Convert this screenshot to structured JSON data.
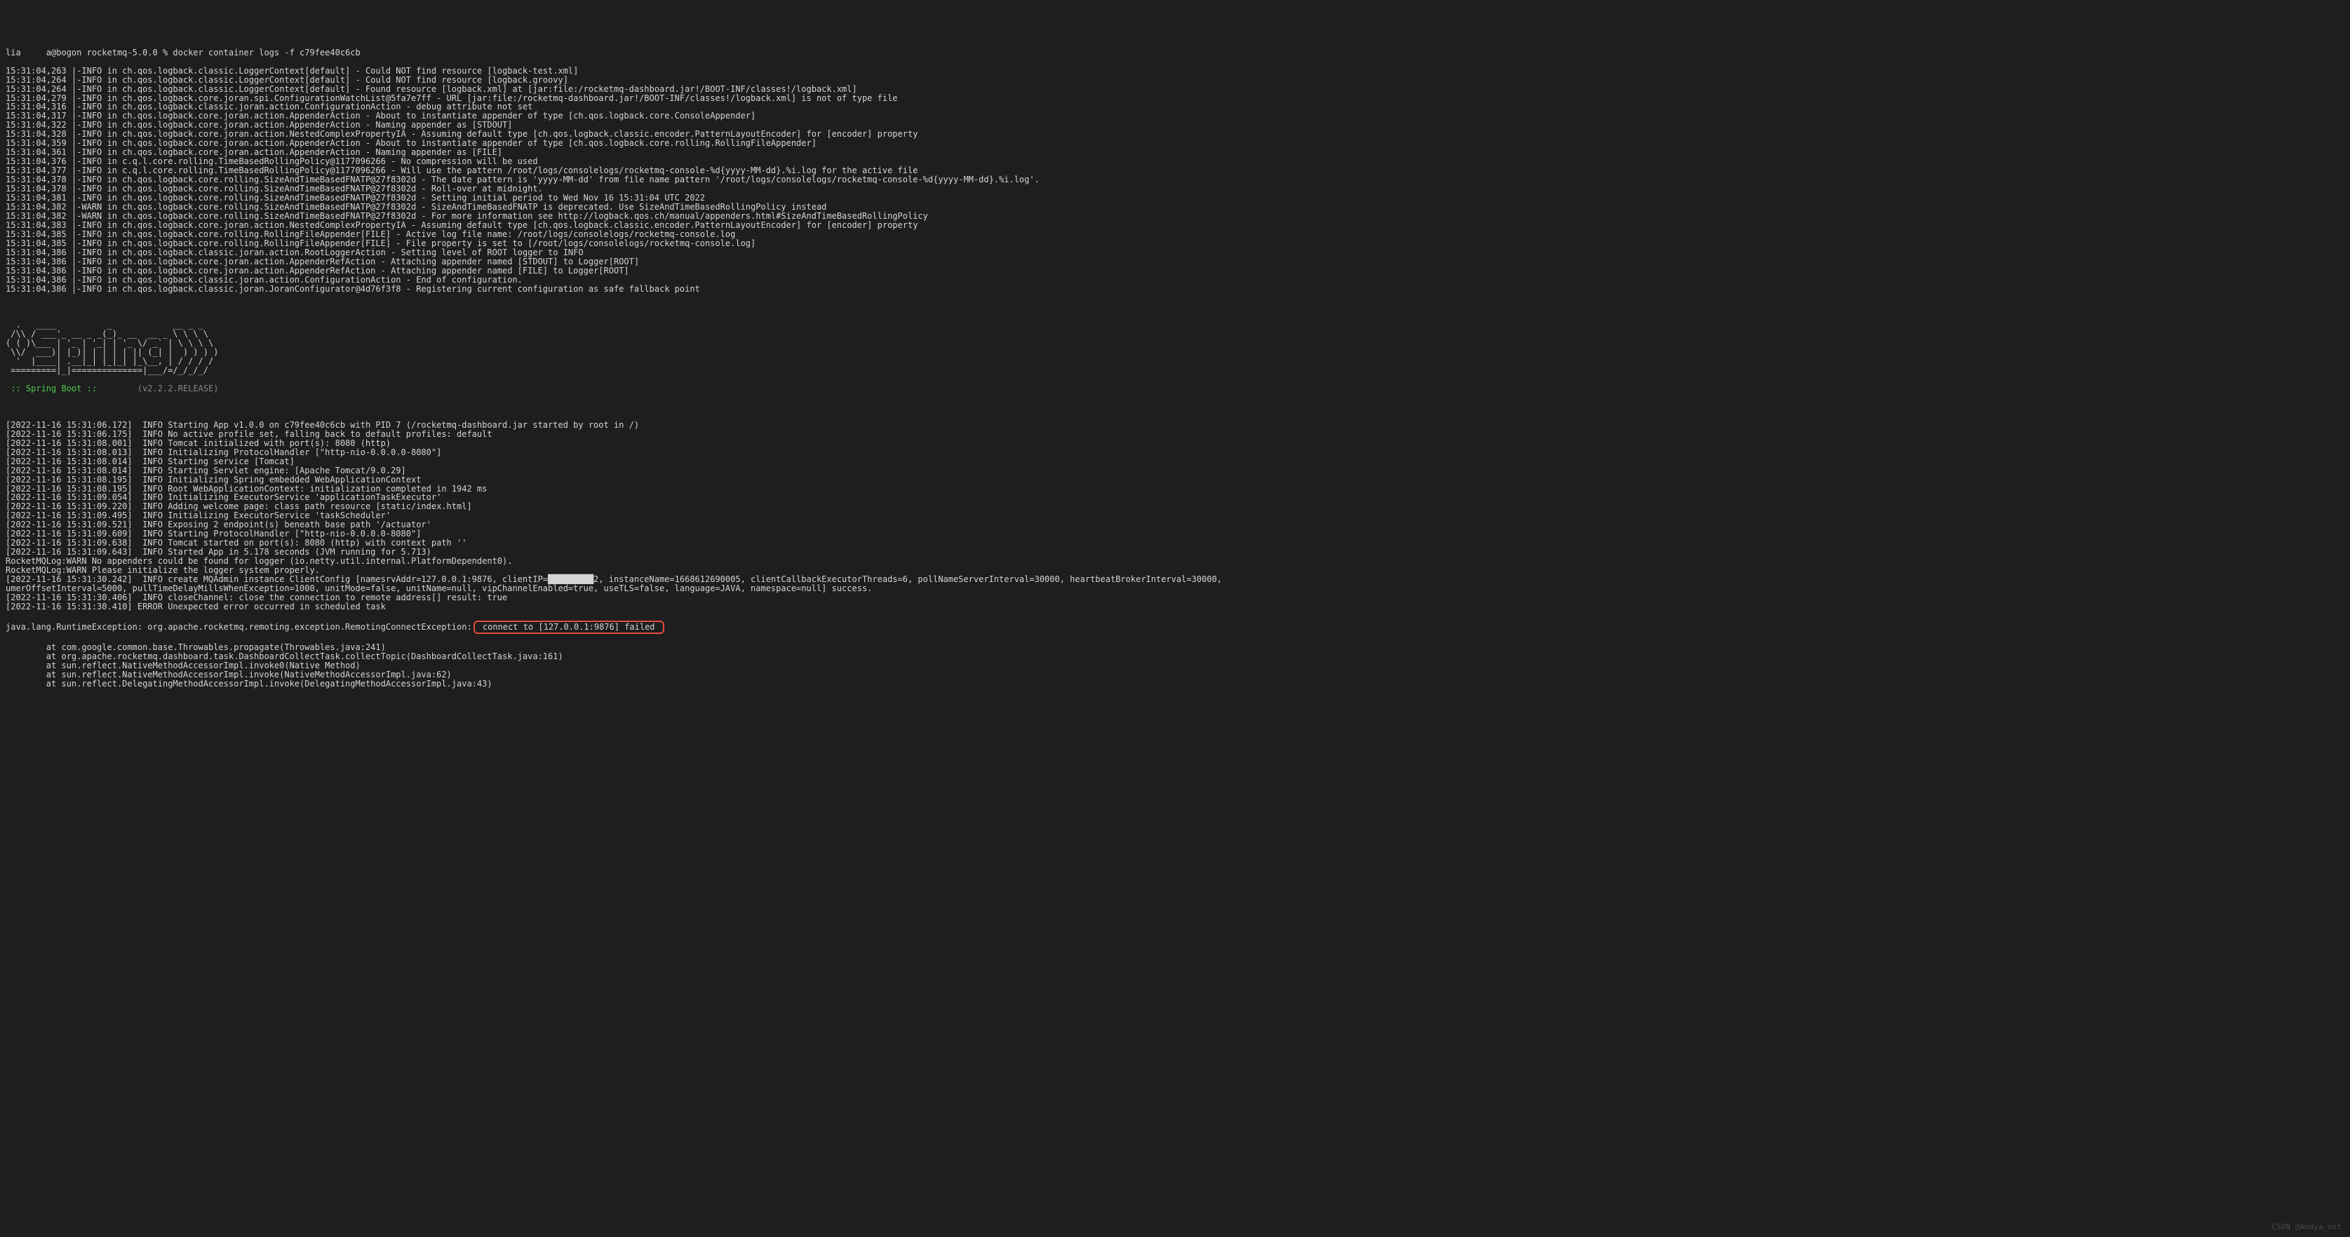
{
  "prompt_line": "lia     a@bogon rocketmq-5.0.0 % docker container logs -f c79fee40c6cb",
  "logback_lines": [
    "15:31:04,263 |-INFO in ch.qos.logback.classic.LoggerContext[default] - Could NOT find resource [logback-test.xml]",
    "15:31:04,264 |-INFO in ch.qos.logback.classic.LoggerContext[default] - Could NOT find resource [logback.groovy]",
    "15:31:04,264 |-INFO in ch.qos.logback.classic.LoggerContext[default] - Found resource [logback.xml] at [jar:file:/rocketmq-dashboard.jar!/BOOT-INF/classes!/logback.xml]",
    "15:31:04,279 |-INFO in ch.qos.logback.core.joran.spi.ConfigurationWatchList@5fa7e7ff - URL [jar:file:/rocketmq-dashboard.jar!/BOOT-INF/classes!/logback.xml] is not of type file",
    "15:31:04,316 |-INFO in ch.qos.logback.classic.joran.action.ConfigurationAction - debug attribute not set",
    "15:31:04,317 |-INFO in ch.qos.logback.core.joran.action.AppenderAction - About to instantiate appender of type [ch.qos.logback.core.ConsoleAppender]",
    "15:31:04,322 |-INFO in ch.qos.logback.core.joran.action.AppenderAction - Naming appender as [STDOUT]",
    "15:31:04,328 |-INFO in ch.qos.logback.core.joran.action.NestedComplexPropertyIA - Assuming default type [ch.qos.logback.classic.encoder.PatternLayoutEncoder] for [encoder] property",
    "15:31:04,359 |-INFO in ch.qos.logback.core.joran.action.AppenderAction - About to instantiate appender of type [ch.qos.logback.core.rolling.RollingFileAppender]",
    "15:31:04,361 |-INFO in ch.qos.logback.core.joran.action.AppenderAction - Naming appender as [FILE]",
    "15:31:04,376 |-INFO in c.q.l.core.rolling.TimeBasedRollingPolicy@1177096266 - No compression will be used",
    "15:31:04,377 |-INFO in c.q.l.core.rolling.TimeBasedRollingPolicy@1177096266 - Will use the pattern /root/logs/consolelogs/rocketmq-console-%d{yyyy-MM-dd}.%i.log for the active file",
    "15:31:04,378 |-INFO in ch.qos.logback.core.rolling.SizeAndTimeBasedFNATP@27f8302d - The date pattern is 'yyyy-MM-dd' from file name pattern '/root/logs/consolelogs/rocketmq-console-%d{yyyy-MM-dd}.%i.log'.",
    "15:31:04,378 |-INFO in ch.qos.logback.core.rolling.SizeAndTimeBasedFNATP@27f8302d - Roll-over at midnight.",
    "15:31:04,381 |-INFO in ch.qos.logback.core.rolling.SizeAndTimeBasedFNATP@27f8302d - Setting initial period to Wed Nov 16 15:31:04 UTC 2022",
    "15:31:04,382 |-WARN in ch.qos.logback.core.rolling.SizeAndTimeBasedFNATP@27f8302d - SizeAndTimeBasedFNATP is deprecated. Use SizeAndTimeBasedRollingPolicy instead",
    "15:31:04,382 |-WARN in ch.qos.logback.core.rolling.SizeAndTimeBasedFNATP@27f8302d - For more information see http://logback.qos.ch/manual/appenders.html#SizeAndTimeBasedRollingPolicy",
    "15:31:04,383 |-INFO in ch.qos.logback.core.joran.action.NestedComplexPropertyIA - Assuming default type [ch.qos.logback.classic.encoder.PatternLayoutEncoder] for [encoder] property",
    "15:31:04,385 |-INFO in ch.qos.logback.core.rolling.RollingFileAppender[FILE] - Active log file name: /root/logs/consolelogs/rocketmq-console.log",
    "15:31:04,385 |-INFO in ch.qos.logback.core.rolling.RollingFileAppender[FILE] - File property is set to [/root/logs/consolelogs/rocketmq-console.log]",
    "15:31:04,386 |-INFO in ch.qos.logback.classic.joran.action.RootLoggerAction - Setting level of ROOT logger to INFO",
    "15:31:04,386 |-INFO in ch.qos.logback.core.joran.action.AppenderRefAction - Attaching appender named [STDOUT] to Logger[ROOT]",
    "15:31:04,386 |-INFO in ch.qos.logback.core.joran.action.AppenderRefAction - Attaching appender named [FILE] to Logger[ROOT]",
    "15:31:04,386 |-INFO in ch.qos.logback.classic.joran.action.ConfigurationAction - End of configuration.",
    "15:31:04,386 |-INFO in ch.qos.logback.classic.joran.JoranConfigurator@4d76f3f8 - Registering current configuration as safe fallback point"
  ],
  "banner": [
    "  .   ____          _            __ _ _",
    " /\\\\ / ___'_ __ _ _(_)_ __  __ _ \\ \\ \\ \\",
    "( ( )\\___ | '_ | '_| | '_ \\/ _` | \\ \\ \\ \\",
    " \\\\/  ___)| |_)| | | | | || (_| |  ) ) ) )",
    "  '  |____| .__|_| |_|_| |_\\__, | / / / /",
    " =========|_|==============|___/=/_/_/_/"
  ],
  "spring_boot_label": " :: Spring Boot ::       ",
  "spring_boot_version": " (v2.2.2.RELEASE)",
  "app_lines": [
    "[2022-11-16 15:31:06.172]  INFO Starting App v1.0.0 on c79fee40c6cb with PID 7 (/rocketmq-dashboard.jar started by root in /)",
    "[2022-11-16 15:31:06.175]  INFO No active profile set, falling back to default profiles: default",
    "[2022-11-16 15:31:08.001]  INFO Tomcat initialized with port(s): 8080 (http)",
    "[2022-11-16 15:31:08.013]  INFO Initializing ProtocolHandler [\"http-nio-0.0.0.0-8080\"]",
    "[2022-11-16 15:31:08.014]  INFO Starting service [Tomcat]",
    "[2022-11-16 15:31:08.014]  INFO Starting Servlet engine: [Apache Tomcat/9.0.29]",
    "[2022-11-16 15:31:08.195]  INFO Initializing Spring embedded WebApplicationContext",
    "[2022-11-16 15:31:08.195]  INFO Root WebApplicationContext: initialization completed in 1942 ms",
    "[2022-11-16 15:31:09.054]  INFO Initializing ExecutorService 'applicationTaskExecutor'",
    "[2022-11-16 15:31:09.220]  INFO Adding welcome page: class path resource [static/index.html]",
    "[2022-11-16 15:31:09.495]  INFO Initializing ExecutorService 'taskScheduler'",
    "[2022-11-16 15:31:09.521]  INFO Exposing 2 endpoint(s) beneath base path '/actuator'",
    "[2022-11-16 15:31:09.609]  INFO Starting ProtocolHandler [\"http-nio-0.0.0.0-8080\"]",
    "[2022-11-16 15:31:09.638]  INFO Tomcat started on port(s): 8080 (http) with context path ''",
    "[2022-11-16 15:31:09.643]  INFO Started App in 5.178 seconds (JVM running for 5.713)",
    "RocketMQLog:WARN No appenders could be found for logger (io.netty.util.internal.PlatformDependent0).",
    "RocketMQLog:WARN Please initialize the logger system properly.",
    "[2022-11-16 15:31:30.242]  INFO create MQAdmin instance ClientConfig [namesrvAddr=127.0.0.1:9876, clientIP=█████████2, instanceName=1668612690005, clientCallbackExecutorThreads=6, pollNameServerInterval=30000, heartbeatBrokerInterval=30000, ",
    "umerOffsetInterval=5000, pullTimeDelayMillsWhenException=1000, unitMode=false, unitName=null, vipChannelEnabled=true, useTLS=false, language=JAVA, namespace=null] success.",
    "[2022-11-16 15:31:30.406]  INFO closeChannel: close the connection to remote address[] result: true",
    "[2022-11-16 15:31:30.410] ERROR Unexpected error occurred in scheduled task"
  ],
  "exception_prefix": "java.lang.RuntimeException: org.apache.rocketmq.remoting.exception.RemotingConnectException:",
  "exception_highlight": " connect to [127.0.0.1:9876] failed ",
  "stacktrace_lines": [
    "        at com.google.common.base.Throwables.propagate(Throwables.java:241)",
    "        at org.apache.rocketmq.dashboard.task.DashboardCollectTask.collectTopic(DashboardCollectTask.java:161)",
    "        at sun.reflect.NativeMethodAccessorImpl.invoke0(Native Method)",
    "        at sun.reflect.NativeMethodAccessorImpl.invoke(NativeMethodAccessorImpl.java:62)",
    "        at sun.reflect.DelegatingMethodAccessorImpl.invoke(DelegatingMethodAccessorImpl.java:43)"
  ],
  "watermark": "CSDN @Andya_net"
}
